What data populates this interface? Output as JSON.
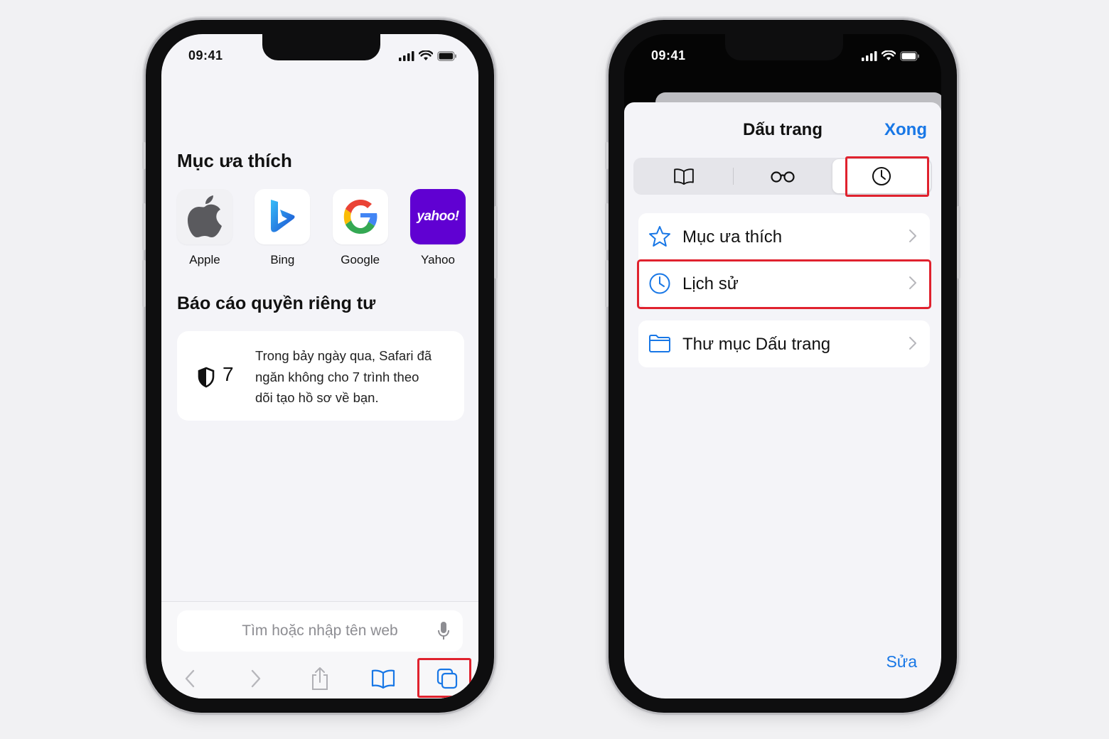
{
  "left_phone": {
    "status": {
      "time": "09:41"
    },
    "favorites": {
      "title": "Mục ưa thích",
      "items": [
        {
          "label": "Apple",
          "icon": "apple-logo-icon"
        },
        {
          "label": "Bing",
          "icon": "bing-logo-icon"
        },
        {
          "label": "Google",
          "icon": "google-logo-icon"
        },
        {
          "label": "Yahoo",
          "icon": "yahoo-logo-icon",
          "logo_text": "yahoo!"
        }
      ]
    },
    "privacy": {
      "title": "Báo cáo quyền riêng tư",
      "count": "7",
      "text": "Trong bảy ngày qua, Safari đã ngăn không cho 7 trình theo dõi tạo hồ sơ về bạn."
    },
    "search": {
      "placeholder": "Tìm hoặc nhập tên web"
    },
    "toolbar": [
      "back-icon",
      "forward-icon",
      "share-icon",
      "bookmarks-icon",
      "tabs-icon"
    ],
    "highlighted": "tabs-button"
  },
  "right_phone": {
    "status": {
      "time": "09:41"
    },
    "sheet": {
      "title": "Dấu trang",
      "done_label": "Xong",
      "segments": [
        "bookmarks-icon",
        "reading-list-icon",
        "history-icon"
      ],
      "selected_segment": "history-icon",
      "items": [
        {
          "label": "Mục ưa thích",
          "icon": "star-icon"
        },
        {
          "label": "Lịch sử",
          "icon": "clock-icon"
        },
        {
          "label": "Thư mục Dấu trang",
          "icon": "folder-icon"
        }
      ],
      "edit_label": "Sửa"
    },
    "highlighted": [
      "history-segment",
      "history-row"
    ]
  },
  "colors": {
    "accent": "#1877e6",
    "highlight": "#e0222e",
    "yahoo": "#6001d2"
  }
}
